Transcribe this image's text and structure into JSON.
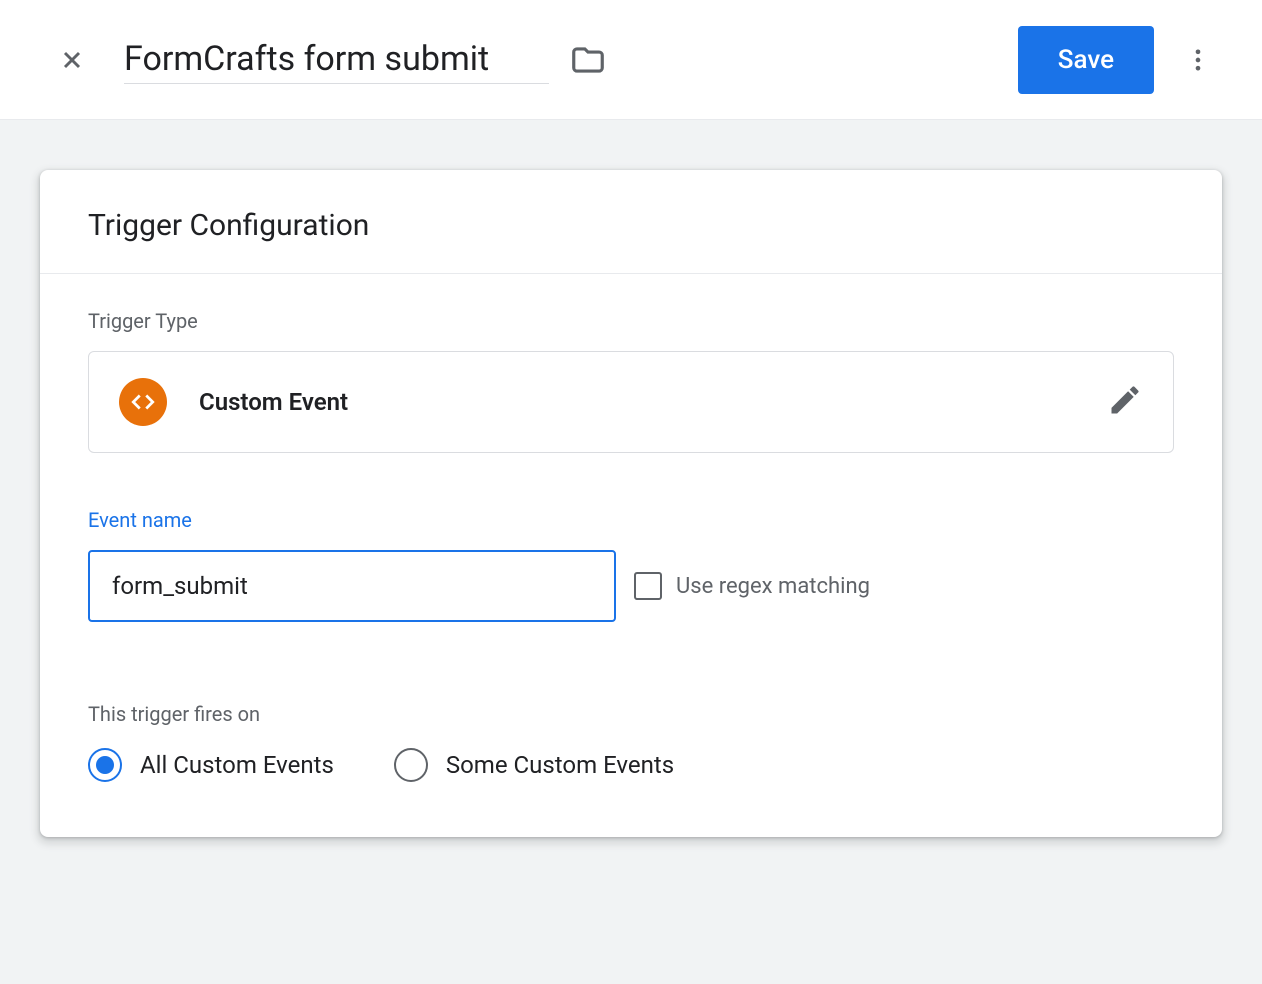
{
  "header": {
    "title": "FormCrafts form submit",
    "save_label": "Save"
  },
  "card": {
    "title": "Trigger Configuration",
    "trigger_type": {
      "label": "Trigger Type",
      "value": "Custom Event"
    },
    "event_name": {
      "label": "Event name",
      "value": "form_submit",
      "regex_label": "Use regex matching",
      "regex_checked": false
    },
    "fires_on": {
      "label": "This trigger fires on",
      "options": [
        {
          "label": "All Custom Events",
          "selected": true
        },
        {
          "label": "Some Custom Events",
          "selected": false
        }
      ]
    }
  }
}
